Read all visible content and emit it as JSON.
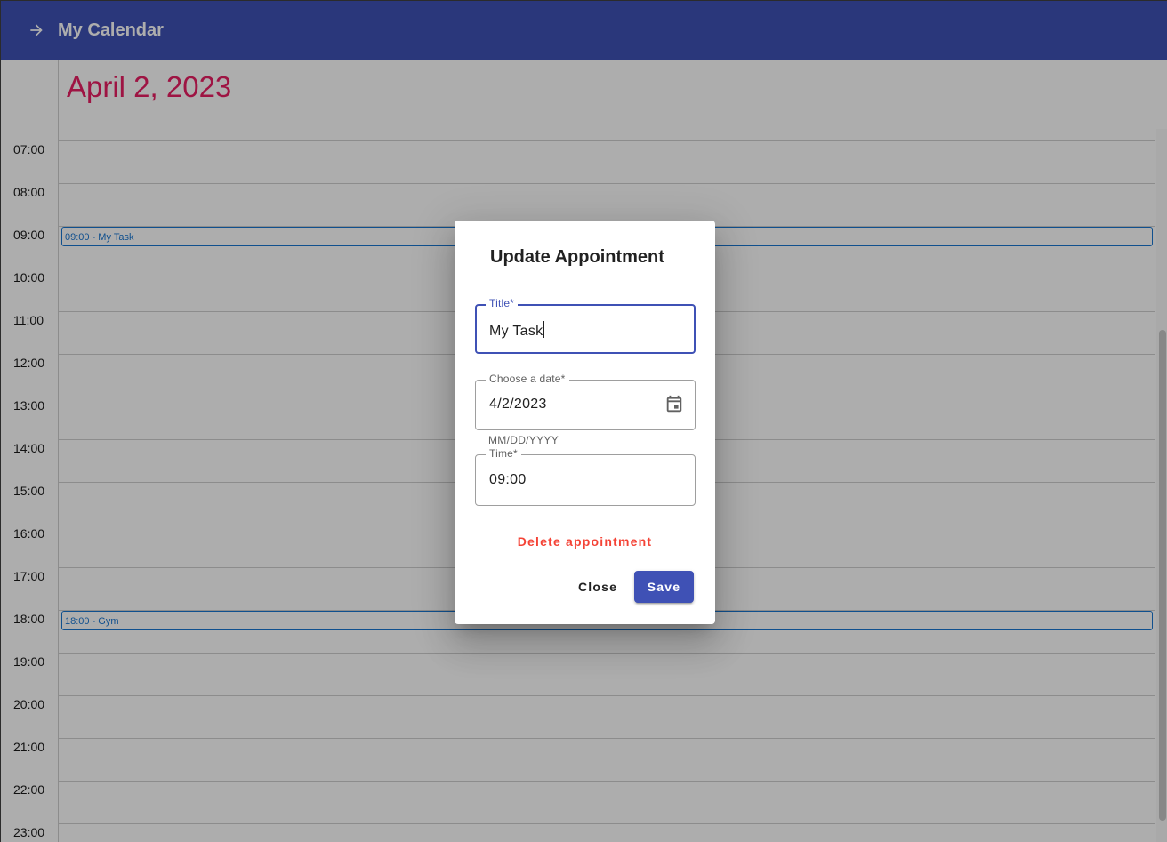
{
  "toolbar": {
    "title": "My Calendar",
    "back_icon": "arrow-right-icon",
    "color": "#3f51b5"
  },
  "calendar": {
    "date_heading": "April 2, 2023",
    "accent_color": "#e91e63",
    "hours": [
      "07:00",
      "08:00",
      "09:00",
      "10:00",
      "11:00",
      "12:00",
      "13:00",
      "14:00",
      "15:00",
      "16:00",
      "17:00",
      "18:00",
      "19:00",
      "20:00",
      "21:00",
      "22:00",
      "23:00"
    ],
    "events": [
      {
        "label": "09:00 - My Task",
        "hour": "09:00"
      },
      {
        "label": "18:00 - Gym",
        "hour": "18:00"
      }
    ]
  },
  "dialog": {
    "title": "Update Appointment",
    "title_field": {
      "label": "Title*",
      "value": "My Task"
    },
    "date_field": {
      "label": "Choose a date*",
      "value": "4/2/2023",
      "hint": "MM/DD/YYYY",
      "icon": "calendar-icon"
    },
    "time_field": {
      "label": "Time*",
      "value": "09:00"
    },
    "delete_label": "Delete appointment",
    "close_label": "Close",
    "save_label": "Save",
    "delete_color": "#f44336",
    "primary_color": "#3f51b5"
  }
}
